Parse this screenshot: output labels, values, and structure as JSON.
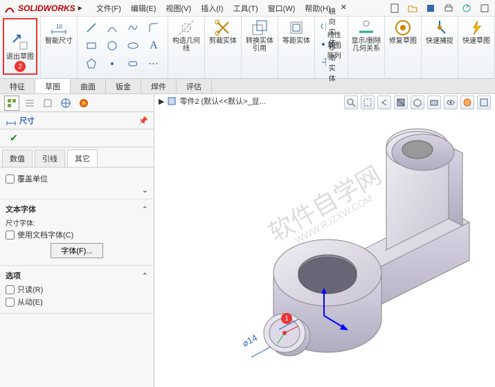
{
  "app": {
    "name": "SOLIDWORKS"
  },
  "menu": {
    "file": "文件(F)",
    "edit": "编辑(E)",
    "view": "视图(V)",
    "insert": "插入(I)",
    "tools": "工具(T)",
    "window": "窗口(W)",
    "help": "帮助(H)",
    "search_icon": "✕"
  },
  "ribbon": {
    "exit_sketch": "退出草图",
    "exit_badge": "2",
    "smart_dim": "智能尺寸",
    "geom_rel": "构造几何线",
    "trim": "剪裁实体",
    "convert": "转换实体引用",
    "offset": "等距实体",
    "mirror": "镜向实体",
    "linear_pattern": "线性草图阵列",
    "move": "移动实体",
    "show_del_rel": "显示/删除几何关系",
    "repair": "修复草图",
    "quick_snap": "快速捕捉",
    "rapid_sketch": "快速草图"
  },
  "tabs": {
    "features": "特征",
    "sketch": "草图",
    "surfaces": "曲面",
    "sheetmetal": "钣金",
    "weldments": "焊件",
    "evaluate": "评估"
  },
  "panel": {
    "dim_title": "尺寸",
    "tab_value": "数值",
    "tab_lead": "引线",
    "tab_other": "其它",
    "override_units": "覆盖单位",
    "text_font": "文本字体",
    "dim_font": "尺寸字体:",
    "use_doc_font": "使用文档字体(C)",
    "font_btn": "字体(F)...",
    "options": "选项",
    "readonly": "只读(R)",
    "driven": "从动(E)"
  },
  "canvas": {
    "doc_name": "零件2 (默认<<默认>_显...",
    "dim_label": "⌀14",
    "callout_badge": "1"
  },
  "watermark": {
    "line1": "软件自学网",
    "line2": "WWW.RJZXW.COM"
  }
}
